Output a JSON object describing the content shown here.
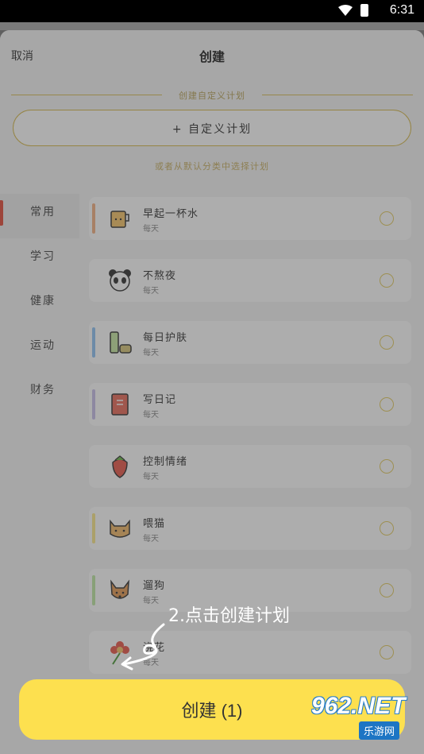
{
  "status": {
    "time": "6:31"
  },
  "header": {
    "cancel": "取消",
    "title": "创建"
  },
  "custom_section": {
    "divider_label": "创建自定义计划",
    "button_label": "+ 自定义计划",
    "hint": "或者从默认分类中选择计划"
  },
  "sidebar": {
    "items": [
      {
        "label": "常用"
      },
      {
        "label": "学习"
      },
      {
        "label": "健康"
      },
      {
        "label": "运动"
      },
      {
        "label": "财务"
      }
    ]
  },
  "plans": [
    {
      "name": "早起一杯水",
      "freq": "每天",
      "icon": "cup-icon",
      "strip": "#f4b183"
    },
    {
      "name": "不熬夜",
      "freq": "每天",
      "icon": "panda-icon",
      "strip": "#ffffff"
    },
    {
      "name": "每日护肤",
      "freq": "每天",
      "icon": "skincare-icon",
      "strip": "#8fc3f5"
    },
    {
      "name": "写日记",
      "freq": "每天",
      "icon": "diary-icon",
      "strip": "#c9c0ea"
    },
    {
      "name": "控制情绪",
      "freq": "每天",
      "icon": "strawberry-icon",
      "strip": "#ffffff"
    },
    {
      "name": "喂猫",
      "freq": "每天",
      "icon": "cat-icon",
      "strip": "#fbe88a"
    },
    {
      "name": "遛狗",
      "freq": "每天",
      "icon": "dog-icon",
      "strip": "#bfe8a4"
    },
    {
      "name": "浇花",
      "freq": "每天",
      "icon": "flower-icon",
      "strip": "#ffffff"
    }
  ],
  "footer": {
    "create_label": "创建 (1)"
  },
  "annotation": {
    "text": "2.点击创建计划"
  },
  "watermark": {
    "logo": "962.NET",
    "sub": "乐游网"
  },
  "colors": {
    "accent": "#fde04f",
    "active_bar": "#e44d3a",
    "border": "#d6b94a"
  }
}
